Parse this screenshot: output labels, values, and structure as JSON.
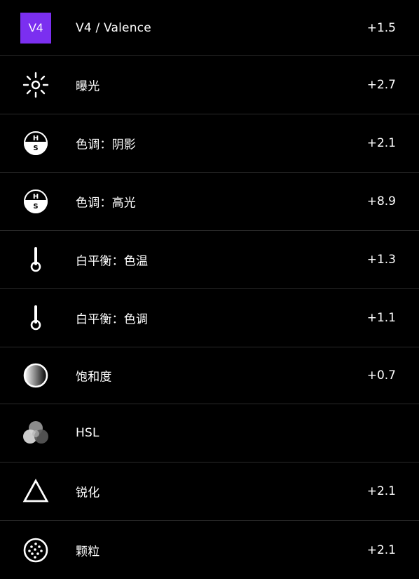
{
  "colors": {
    "background": "#000000",
    "divider": "#2a2a2a",
    "badge": "#7b2ff0",
    "text": "#ffffff"
  },
  "items": [
    {
      "icon": "preset-badge",
      "badge_text": "V4",
      "label": "V4 / Valence",
      "value": "+1.5"
    },
    {
      "icon": "sun-icon",
      "label": "曝光",
      "value": "+2.7"
    },
    {
      "icon": "hs-split-tone-icon",
      "label": "色调：阴影",
      "value": "+2.1"
    },
    {
      "icon": "hs-split-tone-icon",
      "label": "色调：高光",
      "value": "+8.9"
    },
    {
      "icon": "thermometer-icon",
      "label": "白平衡：色温",
      "value": "+1.3"
    },
    {
      "icon": "thermometer-icon",
      "label": "白平衡：色调",
      "value": "+1.1"
    },
    {
      "icon": "gradient-circle-icon",
      "label": "饱和度",
      "value": "+0.7"
    },
    {
      "icon": "hsl-circles-icon",
      "label": "HSL",
      "value": ""
    },
    {
      "icon": "triangle-icon",
      "label": "锐化",
      "value": "+2.1"
    },
    {
      "icon": "grain-icon",
      "label": "颗粒",
      "value": "+2.1"
    }
  ]
}
